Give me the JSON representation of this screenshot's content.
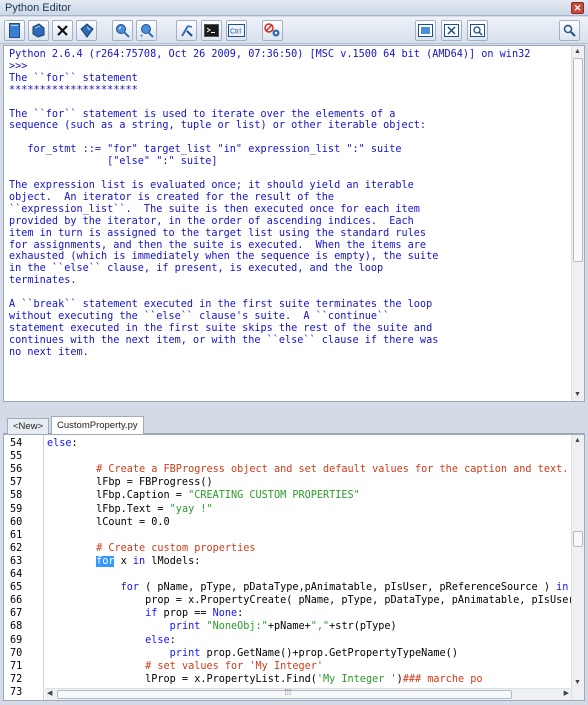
{
  "window": {
    "title": "Python Editor",
    "close_glyph": "✕"
  },
  "toolbar": {
    "buttons": [
      {
        "name": "new-file-icon"
      },
      {
        "name": "open-file-icon"
      },
      {
        "name": "close-icon"
      },
      {
        "name": "save-icon"
      },
      {
        "name": "execute-script-icon"
      },
      {
        "name": "execute-selection-icon"
      },
      {
        "name": "step-icon"
      },
      {
        "name": "console-icon"
      },
      {
        "name": "ctrl-icon"
      },
      {
        "name": "disable-settings-icon"
      }
    ],
    "ctrl_label": "Ctrl",
    "right_buttons": [
      {
        "name": "maximize-icon"
      },
      {
        "name": "clear-icon"
      },
      {
        "name": "find-icon"
      },
      {
        "name": "search-icon"
      }
    ]
  },
  "console": {
    "text": "Python 2.6.4 (r264:75708, Oct 26 2009, 07:36:50) [MSC v.1500 64 bit (AMD64)] on win32\n>>>\nThe ``for`` statement\n*********************\n\nThe ``for`` statement is used to iterate over the elements of a\nsequence (such as a string, tuple or list) or other iterable object:\n\n   for_stmt ::= \"for\" target_list \"in\" expression_list \":\" suite\n                [\"else\" \":\" suite]\n\nThe expression list is evaluated once; it should yield an iterable\nobject.  An iterator is created for the result of the\n``expression_list``.  The suite is then executed once for each item\nprovided by the iterator, in the order of ascending indices.  Each\nitem in turn is assigned to the target list using the standard rules\nfor assignments, and then the suite is executed.  When the items are\nexhausted (which is immediately when the sequence is empty), the suite\nin the ``else`` clause, if present, is executed, and the loop\nterminates.\n\nA ``break`` statement executed in the first suite terminates the loop\nwithout executing the ``else`` clause's suite.  A ``continue``\nstatement executed in the first suite skips the rest of the suite and\ncontinues with the next item, or with the ``else`` clause if there was\nno next item."
  },
  "tabs": [
    {
      "label": "<New>",
      "active": false
    },
    {
      "label": "CustomProperty.py",
      "active": true
    }
  ],
  "editor": {
    "lines": [
      {
        "num": "54",
        "parts": [
          [
            "kw",
            "else"
          ],
          [
            "",
            ":"
          ]
        ]
      },
      {
        "num": "55",
        "parts": []
      },
      {
        "num": "56",
        "parts": [
          [
            "",
            "        "
          ],
          [
            "cm",
            "# Create a FBProgress object and set default values for the caption and text."
          ]
        ]
      },
      {
        "num": "57",
        "parts": [
          [
            "",
            "        lFbp = FBProgress()"
          ]
        ]
      },
      {
        "num": "58",
        "parts": [
          [
            "",
            "        lFbp.Caption = "
          ],
          [
            "st",
            "\"CREATING CUSTOM PROPERTIES\""
          ]
        ]
      },
      {
        "num": "59",
        "parts": [
          [
            "",
            "        lFbp.Text = "
          ],
          [
            "st",
            "\"yay !\""
          ]
        ]
      },
      {
        "num": "60",
        "parts": [
          [
            "",
            "        lCount = 0.0"
          ]
        ]
      },
      {
        "num": "61",
        "parts": []
      },
      {
        "num": "62",
        "parts": [
          [
            "",
            "        "
          ],
          [
            "cm",
            "# Create custom properties"
          ]
        ]
      },
      {
        "num": "63",
        "parts": [
          [
            "",
            "        "
          ],
          [
            "hl",
            "for"
          ],
          [
            "",
            " x "
          ],
          [
            "kw",
            "in"
          ],
          [
            "",
            " lModels:"
          ]
        ]
      },
      {
        "num": "64",
        "parts": []
      },
      {
        "num": "65",
        "parts": [
          [
            "",
            "            "
          ],
          [
            "kw",
            "for"
          ],
          [
            "",
            " ( pName, pType, pDataType,pAnimatable, pIsUser, pReferenceSource ) "
          ],
          [
            "kw",
            "in"
          ],
          [
            "",
            " l"
          ]
        ]
      },
      {
        "num": "66",
        "parts": [
          [
            "",
            "                prop = x.PropertyCreate( pName, pType, pDataType, pAnimatable, pIsUser,"
          ]
        ]
      },
      {
        "num": "67",
        "parts": [
          [
            "",
            "                "
          ],
          [
            "kw",
            "if"
          ],
          [
            "",
            " prop == "
          ],
          [
            "kw",
            "None"
          ],
          [
            "",
            ":"
          ]
        ]
      },
      {
        "num": "68",
        "parts": [
          [
            "",
            "                    "
          ],
          [
            "kw",
            "print"
          ],
          [
            "",
            " "
          ],
          [
            "st",
            "\"NoneObj:\""
          ],
          [
            "",
            "+pName+"
          ],
          [
            "st",
            "\",\""
          ],
          [
            "",
            "+str(pType)"
          ]
        ]
      },
      {
        "num": "69",
        "parts": [
          [
            "",
            "                "
          ],
          [
            "kw",
            "else"
          ],
          [
            "",
            ":"
          ]
        ]
      },
      {
        "num": "70",
        "parts": [
          [
            "",
            "                    "
          ],
          [
            "kw",
            "print"
          ],
          [
            "",
            " prop.GetName()+prop.GetPropertyTypeName()"
          ]
        ]
      },
      {
        "num": "71",
        "parts": [
          [
            "",
            "                "
          ],
          [
            "cm",
            "# set values for 'My Integer'"
          ]
        ]
      },
      {
        "num": "72",
        "parts": [
          [
            "",
            "                lProp = x.PropertyList.Find("
          ],
          [
            "st",
            "'My Integer '"
          ],
          [
            "",
            ")"
          ],
          [
            "cm",
            "### marche po"
          ]
        ]
      },
      {
        "num": "73",
        "parts": []
      }
    ]
  },
  "scroll": {
    "hscroll_grip": "⁞⁞⁞",
    "arrows": {
      "up": "▲",
      "down": "▼",
      "left": "◀",
      "right": "▶"
    }
  }
}
